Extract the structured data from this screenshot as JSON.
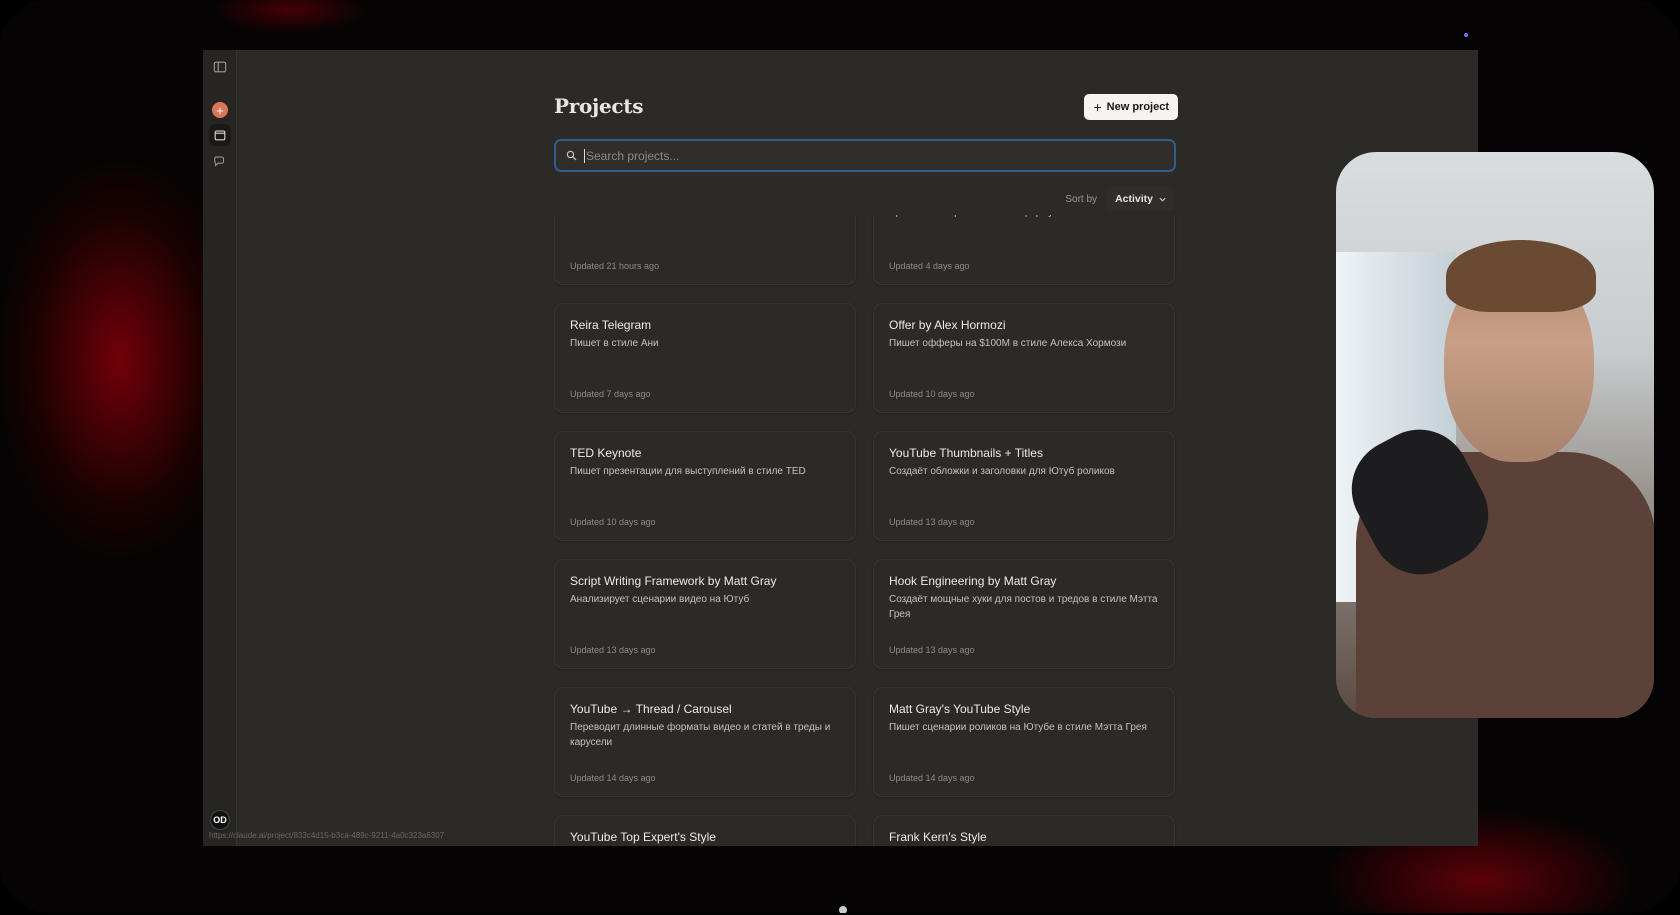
{
  "page": {
    "title": "Projects",
    "new_project_label": "New project"
  },
  "search": {
    "placeholder": "Search projects..."
  },
  "sort": {
    "label": "Sort by",
    "value": "Activity"
  },
  "sidebar": {
    "avatar_initials": "OD",
    "status_url": "https://claude.ai/project/833c4d15-b3ca-489c-9211-4a0c323a6307"
  },
  "projects": [
    {
      "title": "",
      "description": "",
      "updated": "Updated 21 hours ago"
    },
    {
      "title": "",
      "description": "Этот проект помогает формировать цели по методологии Артёма Нестеренко в новой формуле МЛМ",
      "updated": "Updated 4 days ago"
    },
    {
      "title": "Reira Telegram",
      "description": "Пишет в стиле Ани",
      "updated": "Updated 7 days ago"
    },
    {
      "title": "Offer by Alex Hormozi",
      "description": "Пишет офферы на $100M в стиле Алекса Хормози",
      "updated": "Updated 10 days ago"
    },
    {
      "title": "TED Keynote",
      "description": "Пишет презентации для выступлений в стиле TED",
      "updated": "Updated 10 days ago"
    },
    {
      "title": "YouTube Thumbnails + Titles",
      "description": "Создаёт обложки и заголовки для Ютуб роликов",
      "updated": "Updated 13 days ago"
    },
    {
      "title": "Script Writing Framework by Matt Gray",
      "description": "Анализирует сценарии видео на Ютуб",
      "updated": "Updated 13 days ago"
    },
    {
      "title": "Hook Engineering by Matt Gray",
      "description": "Создаёт мощные хуки для постов и тредов в стиле Мэтта Грея",
      "updated": "Updated 13 days ago"
    },
    {
      "title": "YouTube → Thread / Carousel",
      "description": "Переводит длинные форматы видео и статей в треды и карусели",
      "updated": "Updated 14 days ago"
    },
    {
      "title": "Matt Gray's YouTube Style",
      "description": "Пишет сценарии роликов на Ютубе в стиле Мэтта Грея",
      "updated": "Updated 14 days ago"
    },
    {
      "title": "YouTube Top Expert's Style",
      "description": "",
      "updated": ""
    },
    {
      "title": "Frank Kern's Style",
      "description": "",
      "updated": ""
    }
  ],
  "colors": {
    "accent_orange": "#d97757",
    "search_focus": "#2f5d8c",
    "app_bg": "#2b2a27"
  },
  "icons": {
    "sidebar_toggle": "sidebar-toggle-icon",
    "new_chat": "plus-icon",
    "projects": "folder-icon",
    "chats": "chat-bubbles-icon",
    "search": "search-icon",
    "sort": "chevron-down-icon"
  }
}
